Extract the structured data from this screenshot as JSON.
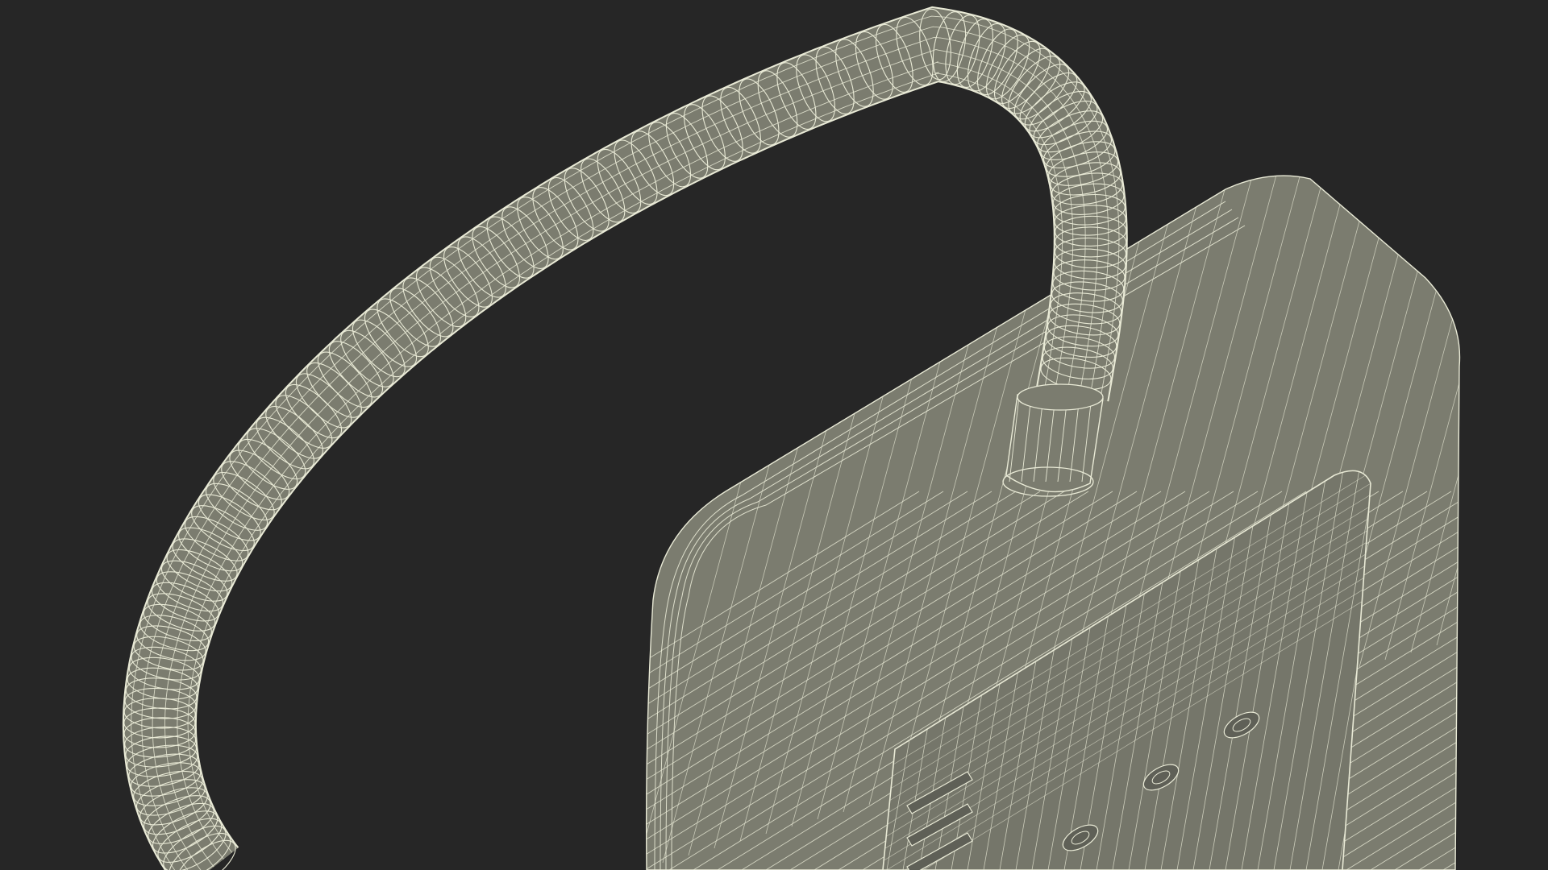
{
  "scene": {
    "description_visible_text": "",
    "background_color": "#262626",
    "surface_color": "#7b7c6f",
    "surface_shadow_color": "#5f6057",
    "wire_color": "#e9ead6",
    "subject_icon": "wireframe-device-with-flexible-hose"
  }
}
